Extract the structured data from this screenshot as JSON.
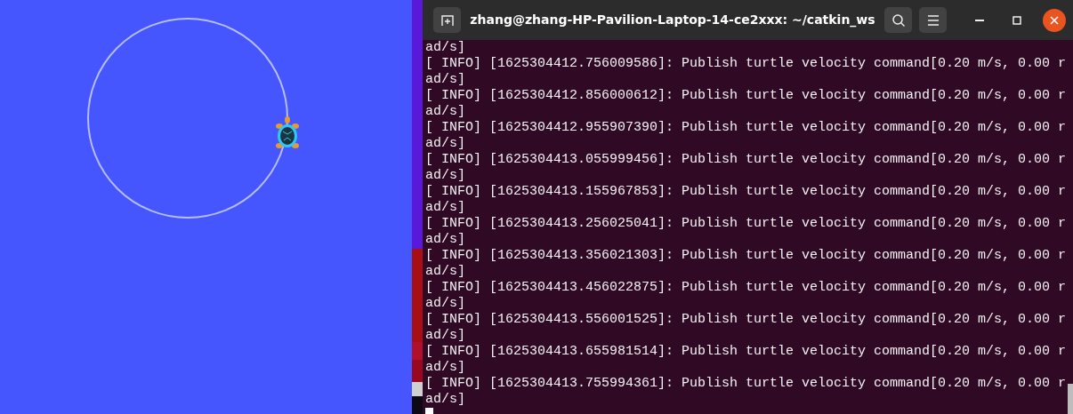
{
  "terminal": {
    "title": "zhang@zhang-HP-Pavilion-Laptop-14-ce2xxx: ~/catkin_ws",
    "lines": [
      "ad/s]",
      "[ INFO] [1625304412.756009586]: Publish turtle velocity command[0.20 m/s, 0.00 r",
      "ad/s]",
      "[ INFO] [1625304412.856000612]: Publish turtle velocity command[0.20 m/s, 0.00 r",
      "ad/s]",
      "[ INFO] [1625304412.955907390]: Publish turtle velocity command[0.20 m/s, 0.00 r",
      "ad/s]",
      "[ INFO] [1625304413.055999456]: Publish turtle velocity command[0.20 m/s, 0.00 r",
      "ad/s]",
      "[ INFO] [1625304413.155967853]: Publish turtle velocity command[0.20 m/s, 0.00 r",
      "ad/s]",
      "[ INFO] [1625304413.256025041]: Publish turtle velocity command[0.20 m/s, 0.00 r",
      "ad/s]",
      "[ INFO] [1625304413.356021303]: Publish turtle velocity command[0.20 m/s, 0.00 r",
      "ad/s]",
      "[ INFO] [1625304413.456022875]: Publish turtle velocity command[0.20 m/s, 0.00 r",
      "ad/s]",
      "[ INFO] [1625304413.556001525]: Publish turtle velocity command[0.20 m/s, 0.00 r",
      "ad/s]",
      "[ INFO] [1625304413.655981514]: Publish turtle velocity command[0.20 m/s, 0.00 r",
      "ad/s]",
      "[ INFO] [1625304413.755994361]: Publish turtle velocity command[0.20 m/s, 0.00 r",
      "ad/s]"
    ]
  }
}
